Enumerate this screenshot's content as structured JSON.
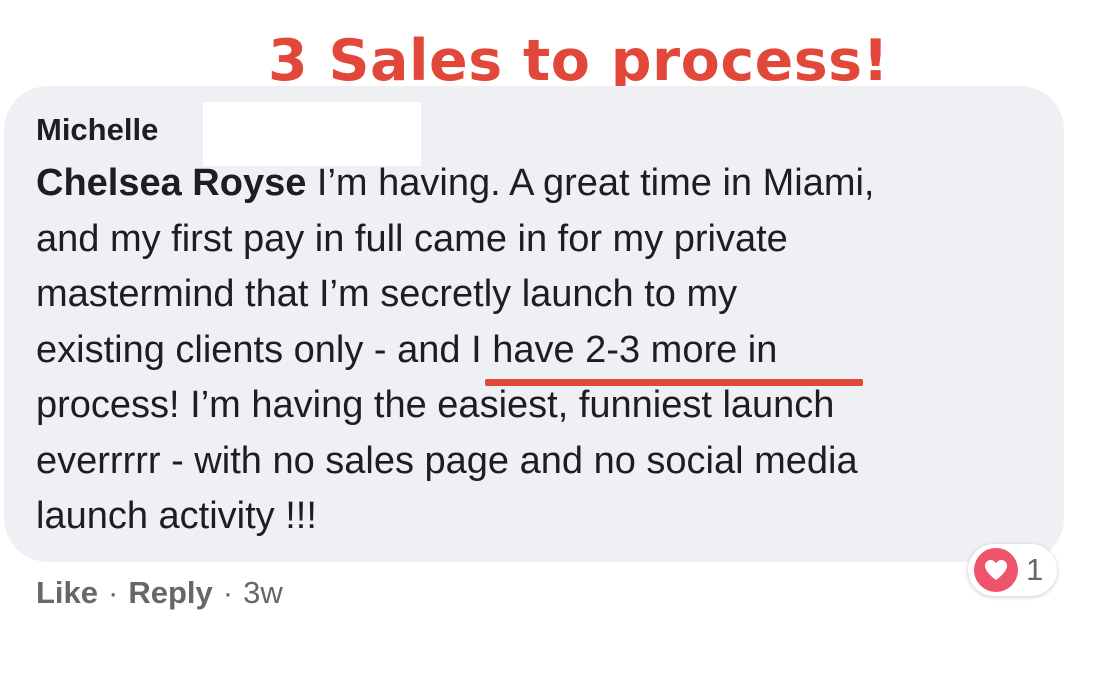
{
  "annotation": {
    "text": "3 Sales to process!",
    "color": "#e2483a"
  },
  "comment": {
    "author": "Michelle",
    "mention": "Chelsea Royse",
    "lines": [
      " I’m having. A great time in Miami,",
      "and my first pay in full came in for my private",
      "mastermind that I’m secretly launch to my",
      "existing clients only - and I have 2-3 more in",
      "process! I’m having the easiest, funniest launch",
      "everrrrr - with no sales page and no social media",
      "launch activity !!!"
    ],
    "bubble_color": "#eff0f3"
  },
  "actions": {
    "like_label": "Like",
    "separator": "·",
    "reply_label": "Reply",
    "timestamp": "3w"
  },
  "reaction": {
    "icon": "heart-icon",
    "count": "1",
    "color": "#f0546d"
  }
}
